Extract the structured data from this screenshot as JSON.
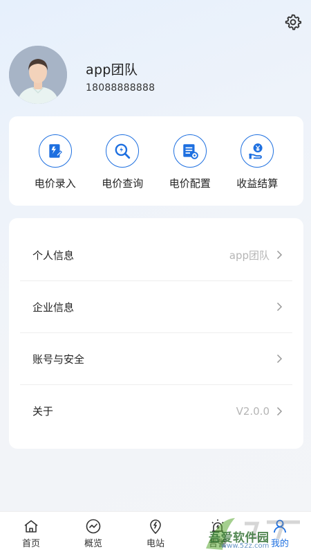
{
  "profile": {
    "name": "app团队",
    "phone": "18088888888"
  },
  "quick_actions": [
    {
      "label": "电价录入",
      "icon": "price-entry-icon"
    },
    {
      "label": "电价查询",
      "icon": "price-query-icon"
    },
    {
      "label": "电价配置",
      "icon": "price-config-icon"
    },
    {
      "label": "收益结算",
      "icon": "revenue-settlement-icon"
    }
  ],
  "menu": [
    {
      "label": "个人信息",
      "value": "app团队"
    },
    {
      "label": "企业信息",
      "value": ""
    },
    {
      "label": "账号与安全",
      "value": ""
    },
    {
      "label": "关于",
      "value": "V2.0.0"
    }
  ],
  "tabbar": {
    "items": [
      {
        "label": "首页",
        "icon": "home-icon"
      },
      {
        "label": "概览",
        "icon": "overview-icon"
      },
      {
        "label": "电站",
        "icon": "station-icon"
      },
      {
        "label": "告警",
        "icon": "alarm-icon"
      },
      {
        "label": "我的",
        "icon": "user-icon"
      }
    ],
    "active_index": 4
  },
  "watermark": {
    "text": "吾爱软件园",
    "url": "www.52z.com",
    "logo_text": "xiazai"
  },
  "colors": {
    "accent": "#1d6fe0",
    "muted": "#b5b5b5"
  }
}
